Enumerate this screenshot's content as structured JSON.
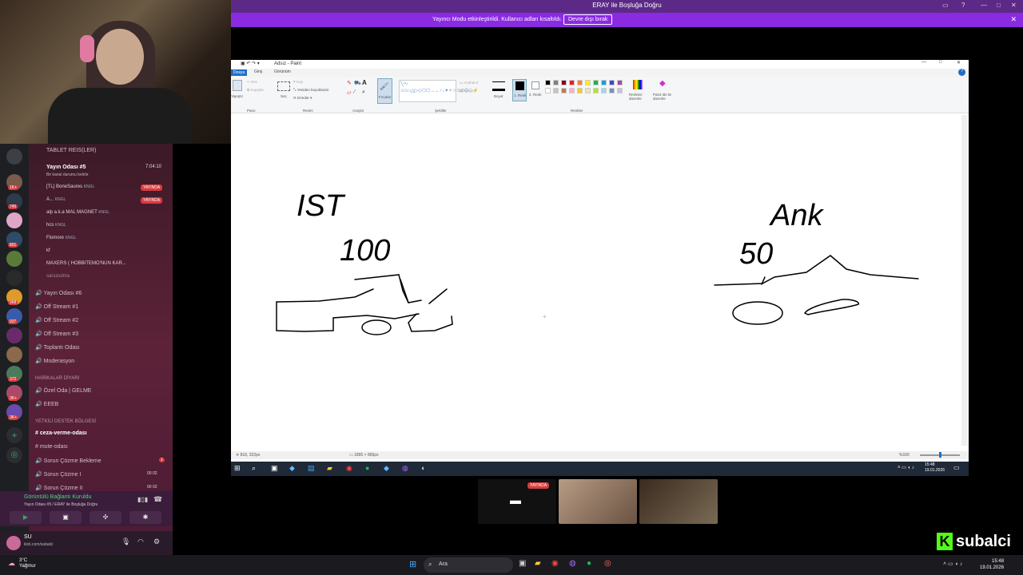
{
  "window": {
    "title": "ERAY ile Boşluğa Doğru"
  },
  "notice": {
    "message": "Yayıncı Modu etkinleştirildi. Kullanıcı adları kısaltıldı.",
    "button": "Devre dışı bırak"
  },
  "servers": {
    "badges": [
      "1K+",
      "745",
      "801",
      "968",
      "937",
      "372",
      "3K+",
      "3K+"
    ]
  },
  "channels": {
    "top_label": "TABLET REIS(LER)",
    "stream": {
      "name": "Yayın Odası #5",
      "time": "7:04:10",
      "status": "Bir kanal durumu belirle"
    },
    "members": [
      {
        "name": "[TL] BoneSaures",
        "tag": "KNGL",
        "live": "YAYINDA"
      },
      {
        "name": "A...",
        "tag": "KNGL",
        "live": "YAYINDA"
      },
      {
        "name": "alp a.k.a MAL MAGNET",
        "tag": "KNGL",
        "live": ""
      },
      {
        "name": "hcs",
        "tag": "KNGL",
        "live": ""
      },
      {
        "name": "Flomore",
        "tag": "KNGL",
        "live": ""
      },
      {
        "name": "kf",
        "tag": "",
        "live": ""
      },
      {
        "name": "MAXERS ( HOBBITEMO'NUN KAR...",
        "tag": "",
        "live": ""
      },
      {
        "name": "sanuzulma",
        "tag": "",
        "live": ""
      }
    ],
    "voice_list": [
      "Yayın Odası #6",
      "Off Stream #1",
      "Off Stream #2",
      "Off Stream #3",
      "Toplantı Odası",
      "Moderasyon"
    ],
    "cat1": "HARİKALAR DİYARI",
    "cat1_items": [
      "Özel Oda | GELME",
      "EEEB"
    ],
    "cat2": "YETKİLİ DESTEK BÖLGESİ",
    "cat2_items": [
      "ceza-verme-odası",
      "mute-odası",
      "Sorun Çözme Bekleme",
      "Sorun Çözme I",
      "Sorun Çözme II"
    ],
    "counts": {
      "bekleme": "1",
      "s1": "00  02",
      "s2": "00  02"
    }
  },
  "voice": {
    "status": "Görüntülü Bağlantı Kuruldu",
    "channel": "Yayın Odası #5 / ERAY ile Boşluğa Doğru"
  },
  "user": {
    "name": "SU",
    "sub": "kick.com/subalci"
  },
  "paint": {
    "title": "Adsız - Paint",
    "tabs": [
      "Dosya",
      "Giriş",
      "Görünüm"
    ],
    "groups": [
      "Pano",
      "Resim",
      "Araçlar",
      "Şekiller",
      "Renkler"
    ],
    "buttons": {
      "paste": "Yapıştır",
      "cut": "Kes",
      "copy": "Kopyala",
      "select": "Seç",
      "crop": "Kırp",
      "resize": "Yeniden boyutlandır",
      "rotate": "Döndür",
      "brushes": "Fırçalar",
      "outline": "Anahat",
      "fill": "Dolgu",
      "size": "Boyut",
      "color1": "1. Renk",
      "color2": "2. Renk",
      "edit_colors": "Renkleri düzenle",
      "paint3d": "Paint 3D ile düzenle"
    },
    "palette": [
      "#000000",
      "#7f7f7f",
      "#880015",
      "#ed1c24",
      "#ff7f27",
      "#fff200",
      "#22b14c",
      "#00a2e8",
      "#3f48cc",
      "#a349a4",
      "#ffffff",
      "#c3c3c3",
      "#b97a57",
      "#ffaec9",
      "#ffc90e",
      "#efe4b0",
      "#b5e61d",
      "#99d9ea",
      "#7092be",
      "#c8bfe7"
    ],
    "drawing": {
      "left_city": "IST",
      "left_number": "100",
      "right_city": "Ank",
      "right_number": "50"
    },
    "status": {
      "cursor": "818, 322px",
      "size": "1895 × 865px",
      "zoom": "%100"
    }
  },
  "cams": {
    "live": "YAYINDA"
  },
  "taskbar": {
    "search": "Ara",
    "weather_temp": "3°C",
    "weather_desc": "Yağmur",
    "time": "15:48",
    "date": "19.01.2026"
  },
  "brand": {
    "name": "subalci"
  }
}
